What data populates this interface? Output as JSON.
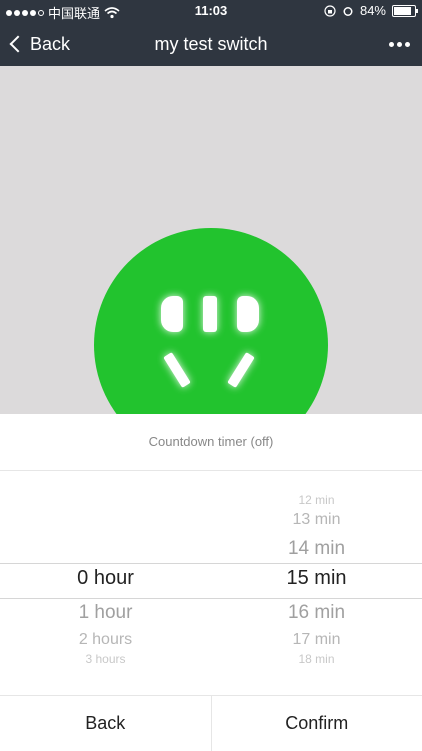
{
  "status_bar": {
    "carrier": "中国联通",
    "time": "11:03",
    "battery_text": "84%",
    "battery_level": 0.84
  },
  "nav": {
    "back_label": "Back",
    "title": "my test switch"
  },
  "device": {
    "icon": "plug-socket-icon",
    "accent_color": "#22c32e"
  },
  "sheet": {
    "title": "Countdown timer (off)",
    "hours": [
      "0 hour",
      "1 hour",
      "2 hours",
      "3 hours"
    ],
    "minutes_above": [
      "12 min",
      "13 min",
      "14 min"
    ],
    "minutes_selected": "15 min",
    "minutes_below": [
      "16 min",
      "17 min",
      "18 min"
    ],
    "back_label": "Back",
    "confirm_label": "Confirm"
  }
}
